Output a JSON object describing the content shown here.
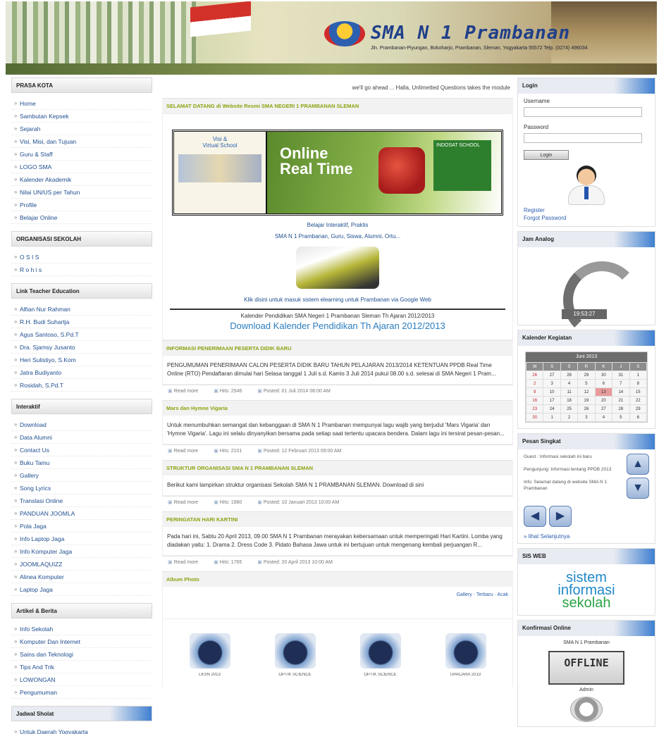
{
  "header": {
    "title": "SMA N 1 Prambanan",
    "subtitle": "Jln. Prambanan-Piyungan, Bokoharjo, Prambanan, Sleman, Yogyakarta 55572  Telp. (0274) 496034"
  },
  "left": {
    "sections": [
      {
        "title": "PRASA KOTA",
        "items": [
          "Home",
          "Sambutan Kepsek",
          "Sejarah",
          "Visi, Misi, dan Tujuan",
          "Guru & Staff",
          "LOGO SMA",
          "Kalender Akademik",
          "Nilai UN/US per Tahun",
          "Profile",
          "Belajar Online"
        ]
      },
      {
        "title": "ORGANISASI SEKOLAH",
        "items": [
          "O S I S",
          "R o h i s"
        ]
      },
      {
        "title": "Link Teacher Education",
        "items": [
          "Alfian Nur Rahman",
          "R.H. Budi Suhartja",
          "Agus Santoso, S.Pd.T",
          "Dra. Sjamsy Jusanto",
          "Heri Sulistiyo, S.Kom",
          "Jatra Budiyanto",
          "Rosidah, S.Pd.T"
        ]
      },
      {
        "title": "Interaktif",
        "items": [
          "Download",
          "Data Alumni",
          "Contact Us",
          "Buku Tamu",
          "Gallery",
          "Song Lyrics",
          "Translasi Online",
          "PANDUAN JOOMLA",
          "Pola Jaga",
          "Info Laptop Jaga",
          "Info Komputer Jaga",
          "JOOMLAQUIZZ",
          "Alinea Komputer",
          "Laptop Jaga"
        ]
      },
      {
        "title": "Artikel & Berita",
        "items": [
          "Info Sekolah",
          "Komputer Dan Internet",
          "Sains dan Teknologi",
          "Tips And Trik",
          "LOWONGAN",
          "Pengumuman"
        ]
      },
      {
        "title": "Jadwal Sholat",
        "items": [
          "Untuk Daerah Yogyakarta"
        ]
      }
    ]
  },
  "main": {
    "marquee": "we'll go ahead ... Halla, Unlimetted Questions takes the module",
    "welcome_heading": "SELAMAT DATANG di Website Resmi SMA NEGERI 1 PRAMBANAN SLEMAN",
    "promo": {
      "visi_line1": "Visi &",
      "visi_line2": "Virtual School",
      "online_line1": "Online",
      "online_line2": "Real Time",
      "card_text": "INDOSAT SCHOOL"
    },
    "tagline_1": "Belajar Interaktif, Praktis",
    "tagline_2": "SMA N 1 Prambanan, Guru, Siswa, Alumni, Ortu...",
    "tagline_3": "Klik disini untuk masuk sistem elearning untuk Prambanan via Google Web",
    "kalender_note": "Kalender Pendidikan SMA Negeri 1 Prambanan Sleman Th Ajaran 2012/2013",
    "kalender_link": "Download Kalender Pendidikan Th Ajaran 2012/2013",
    "articles": [
      {
        "title": "INFORMASI PENERIMAAN PESERTA DIDIK BARU",
        "body": "PENGUMUMAN PENERIMAAN CALON PESERTA DIDIK BARU TAHUN PELAJARAN 2013/2014 KETENTUAN PPDB Real Time Online (RTO) Pendaftaran dimulai hari Selasa tanggal 1 Juli s.d. Kamis 3 Juli 2014 pukul 08.00 s.d. selesai di SMA Negeri 1 Pram...",
        "meta": [
          "Read more",
          "Hits: 2546",
          "Posted: 01 Juli 2014 08:00 AM"
        ]
      },
      {
        "title": "Mars dan Hymne Vigaria",
        "body": "Untuk menumbuhkan semangat dan kebanggaan di SMA N 1 Prambanan mempunyai lagu wajib yang berjudul 'Mars Vigaria' dan 'Hymne Vigaria'. Lagu ini selalu dinyanyikan bersama pada setiap saat tertentu upacara bendera. Dalam lagu ini tersirat pesan-pesan...",
        "meta": [
          "Read more",
          "Hits: 2101",
          "Posted: 12 Februari 2013 09:00 AM"
        ]
      },
      {
        "title": "STRUKTUR ORGANISASI SMA N 1 PRAMBANAN SLEMAN",
        "body": "Berikut kami lampirkan struktur organisasi Sekolah SMA N 1 PRAMBANAN SLEMAN.   Download di sini",
        "meta": [
          "Read more",
          "Hits: 1980",
          "Posted: 10 Januari 2013 10:00 AM"
        ]
      },
      {
        "title": "PERINGATAN HARI KARTINI",
        "body": "Pada hari ini, Sabtu 20 April 2013, 09.00 SMA N 1 Prambanan merayakan kebersamaan untuk memperingati Hari Kartini. Lomba yang diadakan yaitu: 1. Drama 2. Dress Code 3. Pidato Bahasa Jawa untuk ini bertujuan untuk mengenang kembali perjuangan R...",
        "meta": [
          "Read more",
          "Hits: 1765",
          "Posted: 20 April 2013 10:00 AM"
        ]
      }
    ],
    "album": {
      "title": "Album Photo",
      "links": "Gallery · Terbaru · Acak",
      "thumbs": [
        "LKSN 2013",
        "OPTIK SCIENCE",
        "OPTIK SCIENCE",
        "UPACARA 2013"
      ]
    }
  },
  "right": {
    "login": {
      "title": "Login",
      "username_label": "Username",
      "password_label": "Password",
      "button": "Login",
      "register": "Register",
      "forgot": "Forgot Password"
    },
    "clock": {
      "title": "Jam Analog",
      "time": "19:53:27"
    },
    "calendar": {
      "title": "Kalender Kegiatan",
      "month": "Juni 2013",
      "dow": [
        "M",
        "S",
        "S",
        "R",
        "K",
        "J",
        "S"
      ],
      "weeks": [
        [
          "26",
          "27",
          "28",
          "29",
          "30",
          "31",
          "1"
        ],
        [
          "2",
          "3",
          "4",
          "5",
          "6",
          "7",
          "8"
        ],
        [
          "9",
          "10",
          "11",
          "12",
          "13",
          "14",
          "15"
        ],
        [
          "16",
          "17",
          "18",
          "19",
          "20",
          "21",
          "22"
        ],
        [
          "23",
          "24",
          "25",
          "26",
          "27",
          "28",
          "29"
        ],
        [
          "30",
          "1",
          "2",
          "3",
          "4",
          "5",
          "6"
        ]
      ]
    },
    "polls": {
      "title": "Pesan Singkat",
      "line_1": "Guest : Informasi sekolah ini baru",
      "line_2": "Pengunjung: Informasi tentang PPDB 2013",
      "line_3": "Info: Selamat datang di website SMA N 1 Prambanan",
      "more": "» lihat Selanjutnya"
    },
    "sis": {
      "title": "SIS WEB",
      "w1": "sistem",
      "w2": "informasi",
      "w3": "sekolah"
    },
    "konfirmasi": {
      "title": "Konfirmasi Online",
      "org": "SMA N 1 Prambanan",
      "status": "OFFLINE",
      "admin": "Admin"
    }
  }
}
